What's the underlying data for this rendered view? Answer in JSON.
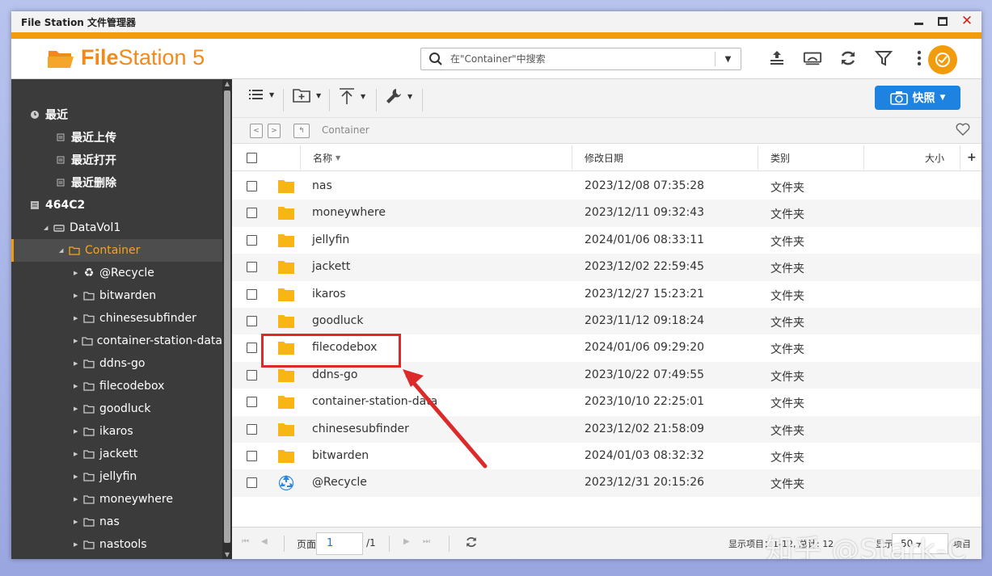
{
  "window": {
    "title": "File Station 文件管理器",
    "controls": [
      "minimize-icon",
      "maximize-icon",
      "close-icon"
    ]
  },
  "header": {
    "logo_bold": "File",
    "logo_rest": "Station 5",
    "search_placeholder": "在\"Container\"中搜索",
    "icons": [
      "upload-queue-icon",
      "network-drive-icon",
      "refresh-icon",
      "filter-icon",
      "more-icon",
      "profile-icon"
    ]
  },
  "sidebar": {
    "items": [
      {
        "label": "最近",
        "icon": "clock-icon"
      },
      {
        "label": "最近上传",
        "icon": "list-icon"
      },
      {
        "label": "最近打开",
        "icon": "list-icon"
      },
      {
        "label": "最近删除",
        "icon": "list-icon"
      },
      {
        "label": "464C2",
        "icon": "nas-icon"
      },
      {
        "label": "DataVol1",
        "icon": "drive-icon"
      },
      {
        "label": "Container",
        "icon": "folder-icon",
        "selected": true
      },
      {
        "label": "@Recycle",
        "icon": "recycle-icon"
      },
      {
        "label": "bitwarden",
        "icon": "folder-icon"
      },
      {
        "label": "chinesesubfinder",
        "icon": "folder-icon"
      },
      {
        "label": "container-station-data",
        "icon": "folder-icon"
      },
      {
        "label": "ddns-go",
        "icon": "folder-icon"
      },
      {
        "label": "filecodebox",
        "icon": "folder-icon"
      },
      {
        "label": "goodluck",
        "icon": "folder-icon"
      },
      {
        "label": "ikaros",
        "icon": "folder-icon"
      },
      {
        "label": "jackett",
        "icon": "folder-icon"
      },
      {
        "label": "jellyfin",
        "icon": "folder-icon"
      },
      {
        "label": "moneywhere",
        "icon": "folder-icon"
      },
      {
        "label": "nas",
        "icon": "folder-icon"
      },
      {
        "label": "nastools",
        "icon": "folder-icon"
      }
    ]
  },
  "toolbar": {
    "snapshot_label": "快照"
  },
  "path": {
    "current": "Container"
  },
  "columns": {
    "name": "名称",
    "modified": "修改日期",
    "type": "类别",
    "size": "大小"
  },
  "files": [
    {
      "name": "nas",
      "date": "2023/12/08 07:35:28",
      "type": "文件夹",
      "icon": "folder-icon"
    },
    {
      "name": "moneywhere",
      "date": "2023/12/11 09:32:43",
      "type": "文件夹",
      "icon": "folder-icon"
    },
    {
      "name": "jellyfin",
      "date": "2024/01/06 08:33:11",
      "type": "文件夹",
      "icon": "folder-icon"
    },
    {
      "name": "jackett",
      "date": "2023/12/02 22:59:45",
      "type": "文件夹",
      "icon": "folder-icon"
    },
    {
      "name": "ikaros",
      "date": "2023/12/27 15:23:21",
      "type": "文件夹",
      "icon": "folder-icon"
    },
    {
      "name": "goodluck",
      "date": "2023/11/12 09:18:24",
      "type": "文件夹",
      "icon": "folder-icon"
    },
    {
      "name": "filecodebox",
      "date": "2024/01/06 09:29:20",
      "type": "文件夹",
      "icon": "folder-icon"
    },
    {
      "name": "ddns-go",
      "date": "2023/10/22 07:49:55",
      "type": "文件夹",
      "icon": "folder-icon"
    },
    {
      "name": "container-station-data",
      "date": "2023/10/10 22:25:01",
      "type": "文件夹",
      "icon": "folder-icon"
    },
    {
      "name": "chinesesubfinder",
      "date": "2023/12/02 21:58:09",
      "type": "文件夹",
      "icon": "folder-icon"
    },
    {
      "name": "bitwarden",
      "date": "2024/01/03 08:32:32",
      "type": "文件夹",
      "icon": "folder-icon"
    },
    {
      "name": "@Recycle",
      "date": "2023/12/31 20:15:26",
      "type": "文件夹",
      "icon": "recycle-icon"
    }
  ],
  "footer": {
    "page_label": "页面",
    "page_value": "1",
    "page_total": "/1",
    "display_text": "显示项目：",
    "display_range": "1-12,",
    "total_label": "总计:",
    "total_value": "12",
    "show_label": "显示",
    "per_page": "50",
    "items_label": "项目"
  },
  "watermark": "知乎 @Stark-C",
  "colors": {
    "accent": "#f29b0c",
    "sidebar_bg": "#3b3b3b",
    "selected_text": "#f6a41d",
    "snapshot_button": "#1d82e0",
    "highlight_box": "#dc2a2a",
    "folder": "#f7b614"
  }
}
